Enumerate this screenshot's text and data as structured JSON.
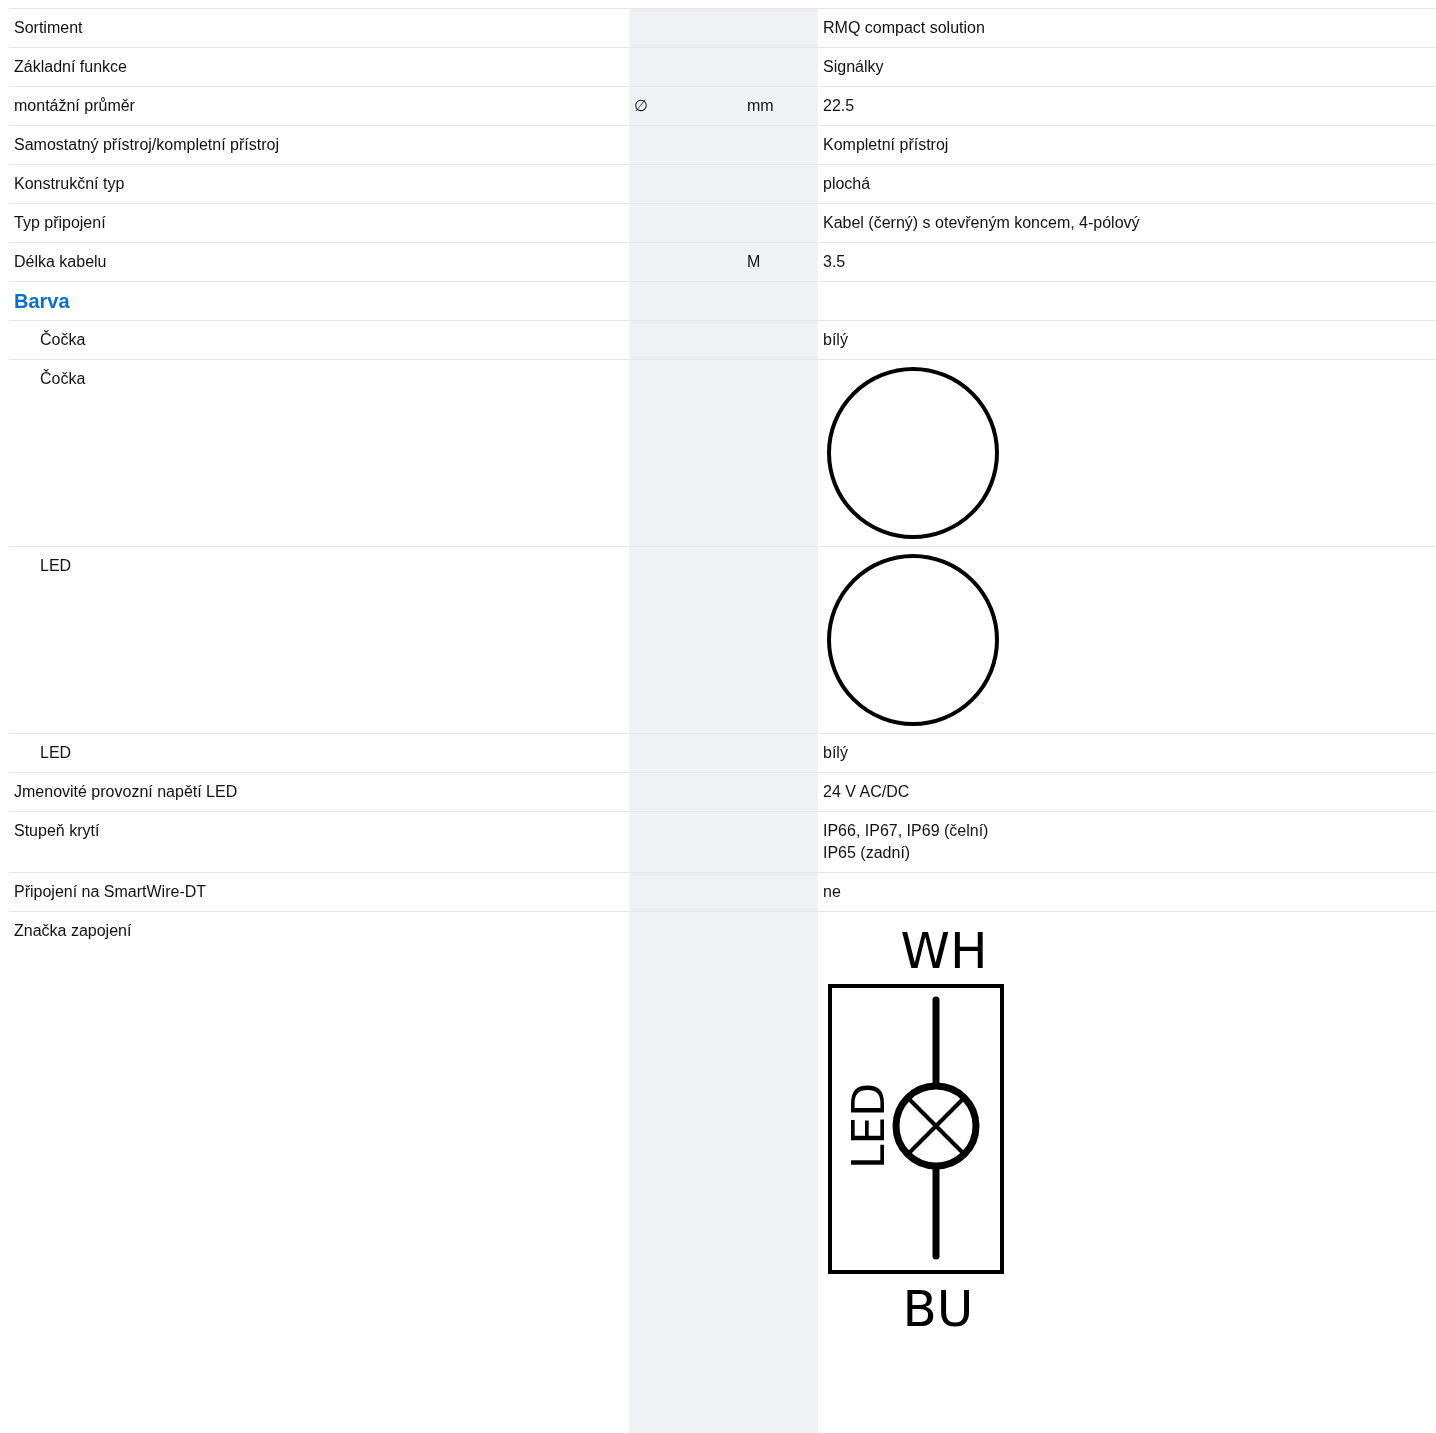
{
  "rows": [
    {
      "kind": "text",
      "label": "Sortiment",
      "value": [
        "RMQ compact solution"
      ]
    },
    {
      "kind": "text",
      "label": "Základní funkce",
      "value": [
        "Signálky"
      ]
    },
    {
      "kind": "text",
      "label": "montážní průměr",
      "symbol": "∅",
      "unit": "mm",
      "value": [
        "22.5"
      ]
    },
    {
      "kind": "text",
      "label": "Samostatný přístroj/kompletní přístroj",
      "value": [
        "Kompletní přístroj"
      ]
    },
    {
      "kind": "text",
      "label": "Konstrukční typ",
      "value": [
        "plochá"
      ]
    },
    {
      "kind": "text",
      "label": "Typ připojení",
      "value": [
        "Kabel (černý) s otevřeným koncem, 4-pólový"
      ]
    },
    {
      "kind": "text",
      "label": "Délka kabelu",
      "unit": "M",
      "value": [
        "3.5"
      ]
    },
    {
      "kind": "section",
      "label": "Barva",
      "children": [
        {
          "kind": "text",
          "label": "Čočka",
          "value": [
            "bílý"
          ]
        },
        {
          "kind": "circle",
          "label": "Čočka"
        },
        {
          "kind": "circle",
          "label": "LED"
        },
        {
          "kind": "text",
          "label": "LED",
          "value": [
            "bílý"
          ]
        }
      ]
    },
    {
      "kind": "text",
      "label": "Jmenovité provozní napětí LED",
      "value": [
        "24 V AC/DC"
      ]
    },
    {
      "kind": "text",
      "label": "Stupeň krytí",
      "value": [
        "IP66, IP67, IP69 (čelní)",
        "IP65 (zadní)"
      ]
    },
    {
      "kind": "text",
      "label": "Připojení na SmartWire-DT",
      "value": [
        "ne"
      ]
    },
    {
      "kind": "diagram",
      "label": "Značka zapojení",
      "top": "WH",
      "bottom": "BU",
      "side": "LED"
    }
  ]
}
